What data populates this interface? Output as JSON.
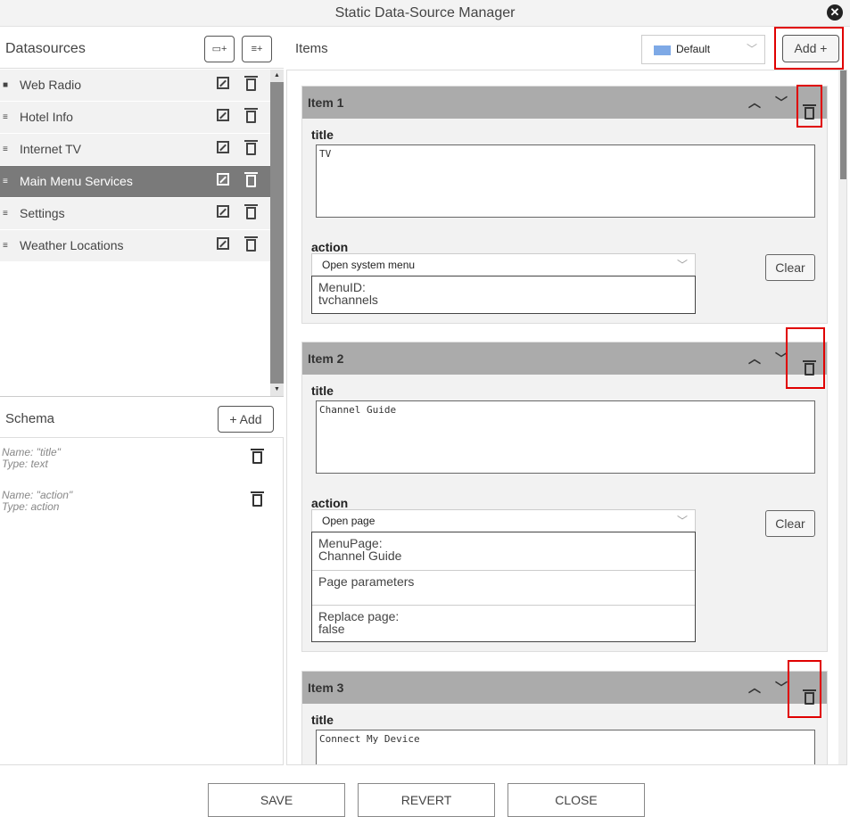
{
  "window": {
    "title": "Static Data-Source Manager",
    "close_icon": "close-circle-icon"
  },
  "datasources": {
    "header": "Datasources",
    "add_folder_icon": "folder-plus-icon",
    "add_datasource_icon": "database-plus-icon",
    "items": [
      {
        "label": "Web Radio",
        "icon": "folder-icon",
        "selected": false
      },
      {
        "label": "Hotel Info",
        "icon": "database-icon",
        "selected": false
      },
      {
        "label": "Internet TV",
        "icon": "database-icon",
        "selected": false
      },
      {
        "label": "Main Menu Services",
        "icon": "database-icon",
        "selected": true
      },
      {
        "label": "Settings",
        "icon": "database-icon",
        "selected": false
      },
      {
        "label": "Weather Locations",
        "icon": "database-icon",
        "selected": false
      }
    ]
  },
  "schema": {
    "header": "Schema",
    "add_label": "+ Add",
    "fields": [
      {
        "name": "Name: \"title\"",
        "type": "Type: text"
      },
      {
        "name": "Name: \"action\"",
        "type": "Type: action"
      }
    ]
  },
  "items_panel": {
    "header": "Items",
    "language": "Default",
    "add_label": "Add +",
    "items": [
      {
        "header": "Item 1",
        "title_label": "title",
        "title_value": "TV",
        "action_label": "action",
        "action_value": "Open system menu",
        "clear_label": "Clear",
        "params": [
          {
            "label": "MenuID:",
            "value": "tvchannels"
          }
        ]
      },
      {
        "header": "Item 2",
        "title_label": "title",
        "title_value": "Channel Guide",
        "action_label": "action",
        "action_value": "Open page",
        "clear_label": "Clear",
        "params": [
          {
            "label": "MenuPage:",
            "value": "Channel Guide"
          },
          {
            "label": "Page parameters",
            "value": ""
          },
          {
            "label": "Replace page:",
            "value": "false"
          }
        ]
      },
      {
        "header": "Item 3",
        "title_label": "title",
        "title_value": "Connect My Device"
      }
    ]
  },
  "footer": {
    "save": "SAVE",
    "revert": "REVERT",
    "close": "CLOSE"
  },
  "colors": {
    "selected_row": "#7a7a7a",
    "card_header": "#ababab",
    "highlight": "#e00000"
  }
}
